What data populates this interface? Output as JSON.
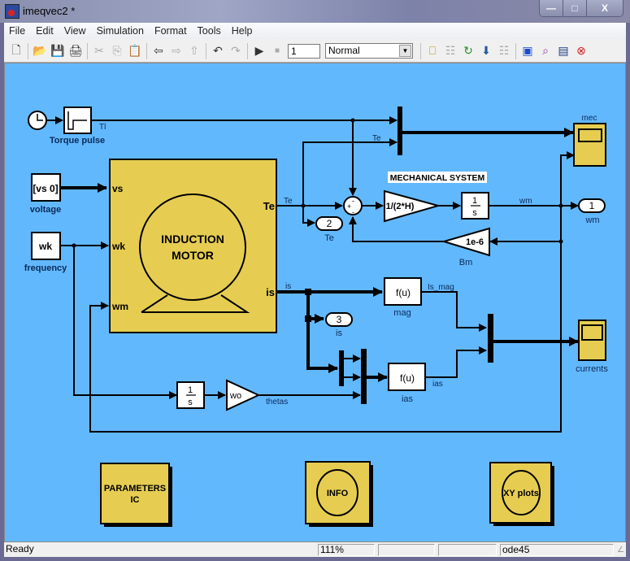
{
  "window": {
    "title": "imeqvec2 *",
    "controls": {
      "minimize": "—",
      "maximize": "□",
      "close": "X"
    }
  },
  "menubar": {
    "items": [
      "File",
      "Edit",
      "View",
      "Simulation",
      "Format",
      "Tools",
      "Help"
    ]
  },
  "toolbar": {
    "buttons": [
      {
        "name": "new-icon",
        "glyph": "🗋",
        "enabled": true
      },
      {
        "name": "open-icon",
        "glyph": "📂",
        "enabled": true
      },
      {
        "name": "save-icon",
        "glyph": "💾",
        "enabled": true
      },
      {
        "name": "print-icon",
        "glyph": "🖨",
        "enabled": true
      },
      {
        "name": "cut-icon",
        "glyph": "✂",
        "enabled": false
      },
      {
        "name": "copy-icon",
        "glyph": "⎘",
        "enabled": false
      },
      {
        "name": "paste-icon",
        "glyph": "📋",
        "enabled": true
      },
      {
        "name": "back-icon",
        "glyph": "⇦",
        "enabled": true
      },
      {
        "name": "forward-icon",
        "glyph": "⇨",
        "enabled": false
      },
      {
        "name": "up-icon",
        "glyph": "⇧",
        "enabled": false
      },
      {
        "name": "undo-icon",
        "glyph": "↶",
        "enabled": true
      },
      {
        "name": "redo-icon",
        "glyph": "↷",
        "enabled": false
      },
      {
        "name": "start-simulation-icon",
        "glyph": "▶",
        "enabled": true
      },
      {
        "name": "stop-simulation-icon",
        "glyph": "■",
        "enabled": false
      }
    ],
    "stop_time": "1",
    "sim_mode": "Normal",
    "right_buttons": [
      {
        "name": "build-icon",
        "glyph": "⎕",
        "enabled": true
      },
      {
        "name": "update-diagram-icon",
        "glyph": "☷",
        "enabled": false
      },
      {
        "name": "refresh-icon",
        "glyph": "↻",
        "enabled": true
      },
      {
        "name": "incremental-build-icon",
        "glyph": "⬇",
        "enabled": true
      },
      {
        "name": "build-subsystem-icon",
        "glyph": "☷",
        "enabled": false
      },
      {
        "name": "library-browser-icon",
        "glyph": "▣",
        "enabled": true
      },
      {
        "name": "model-explorer-icon",
        "glyph": "⌕",
        "enabled": true
      },
      {
        "name": "model-browser-icon",
        "glyph": "▤",
        "enabled": true
      },
      {
        "name": "debug-icon",
        "glyph": "⊗",
        "enabled": true
      }
    ]
  },
  "diagram": {
    "colors": {
      "background": "#62b8fc",
      "subsystem": "#e6cd52",
      "block": "#ffffff",
      "line": "#000000",
      "label": "#0a2a5a"
    },
    "blocks": {
      "clock": {
        "label": ""
      },
      "torque_pulse": {
        "label": "Torque pulse",
        "signal": "Tl"
      },
      "voltage": {
        "label": "voltage",
        "value": "[vs 0]"
      },
      "frequency": {
        "label": "frequency",
        "value": "wk"
      },
      "induction_motor": {
        "title_line1": "INDUCTION",
        "title_line2": "MOTOR",
        "inputs": [
          "vs",
          "wk",
          "wm"
        ],
        "outputs": [
          "Te",
          "is"
        ]
      },
      "mechanical_system_label": "MECHANICAL SYSTEM",
      "gain_inertia": {
        "value": "1/(2*H)"
      },
      "integrator_speed": {
        "num": "1",
        "den": "s"
      },
      "gain_friction": {
        "value": "1e-6",
        "label": "Bm"
      },
      "outport_wm": {
        "number": "1",
        "label": "wm"
      },
      "outport_te": {
        "number": "2",
        "label": "Te"
      },
      "outport_is": {
        "number": "3",
        "label": "is"
      },
      "fcn_mag": {
        "expr": "f(u)",
        "label": "mag"
      },
      "fcn_ias": {
        "expr": "f(u)",
        "label": "ias"
      },
      "integrator_theta": {
        "num": "1",
        "den": "s"
      },
      "gain_wo": {
        "value": "wo"
      },
      "scope_mec": {
        "label": "mec"
      },
      "scope_currents": {
        "label": "currents"
      },
      "parameters_ic": {
        "line1": "PARAMETERS",
        "line2": "IC"
      },
      "info": {
        "label": "INFO"
      },
      "xy_plots": {
        "label": "XY plots"
      }
    },
    "signal_labels": {
      "tl": "Tl",
      "te_top": "Te",
      "te_out": "Te",
      "wm": "wm",
      "is": "is",
      "is_mag": "Is_mag",
      "ias": "ias",
      "thetas": "thetas"
    }
  },
  "statusbar": {
    "status": "Ready",
    "zoom": "111%",
    "cell3": "",
    "cell4": "",
    "solver": "ode45"
  }
}
